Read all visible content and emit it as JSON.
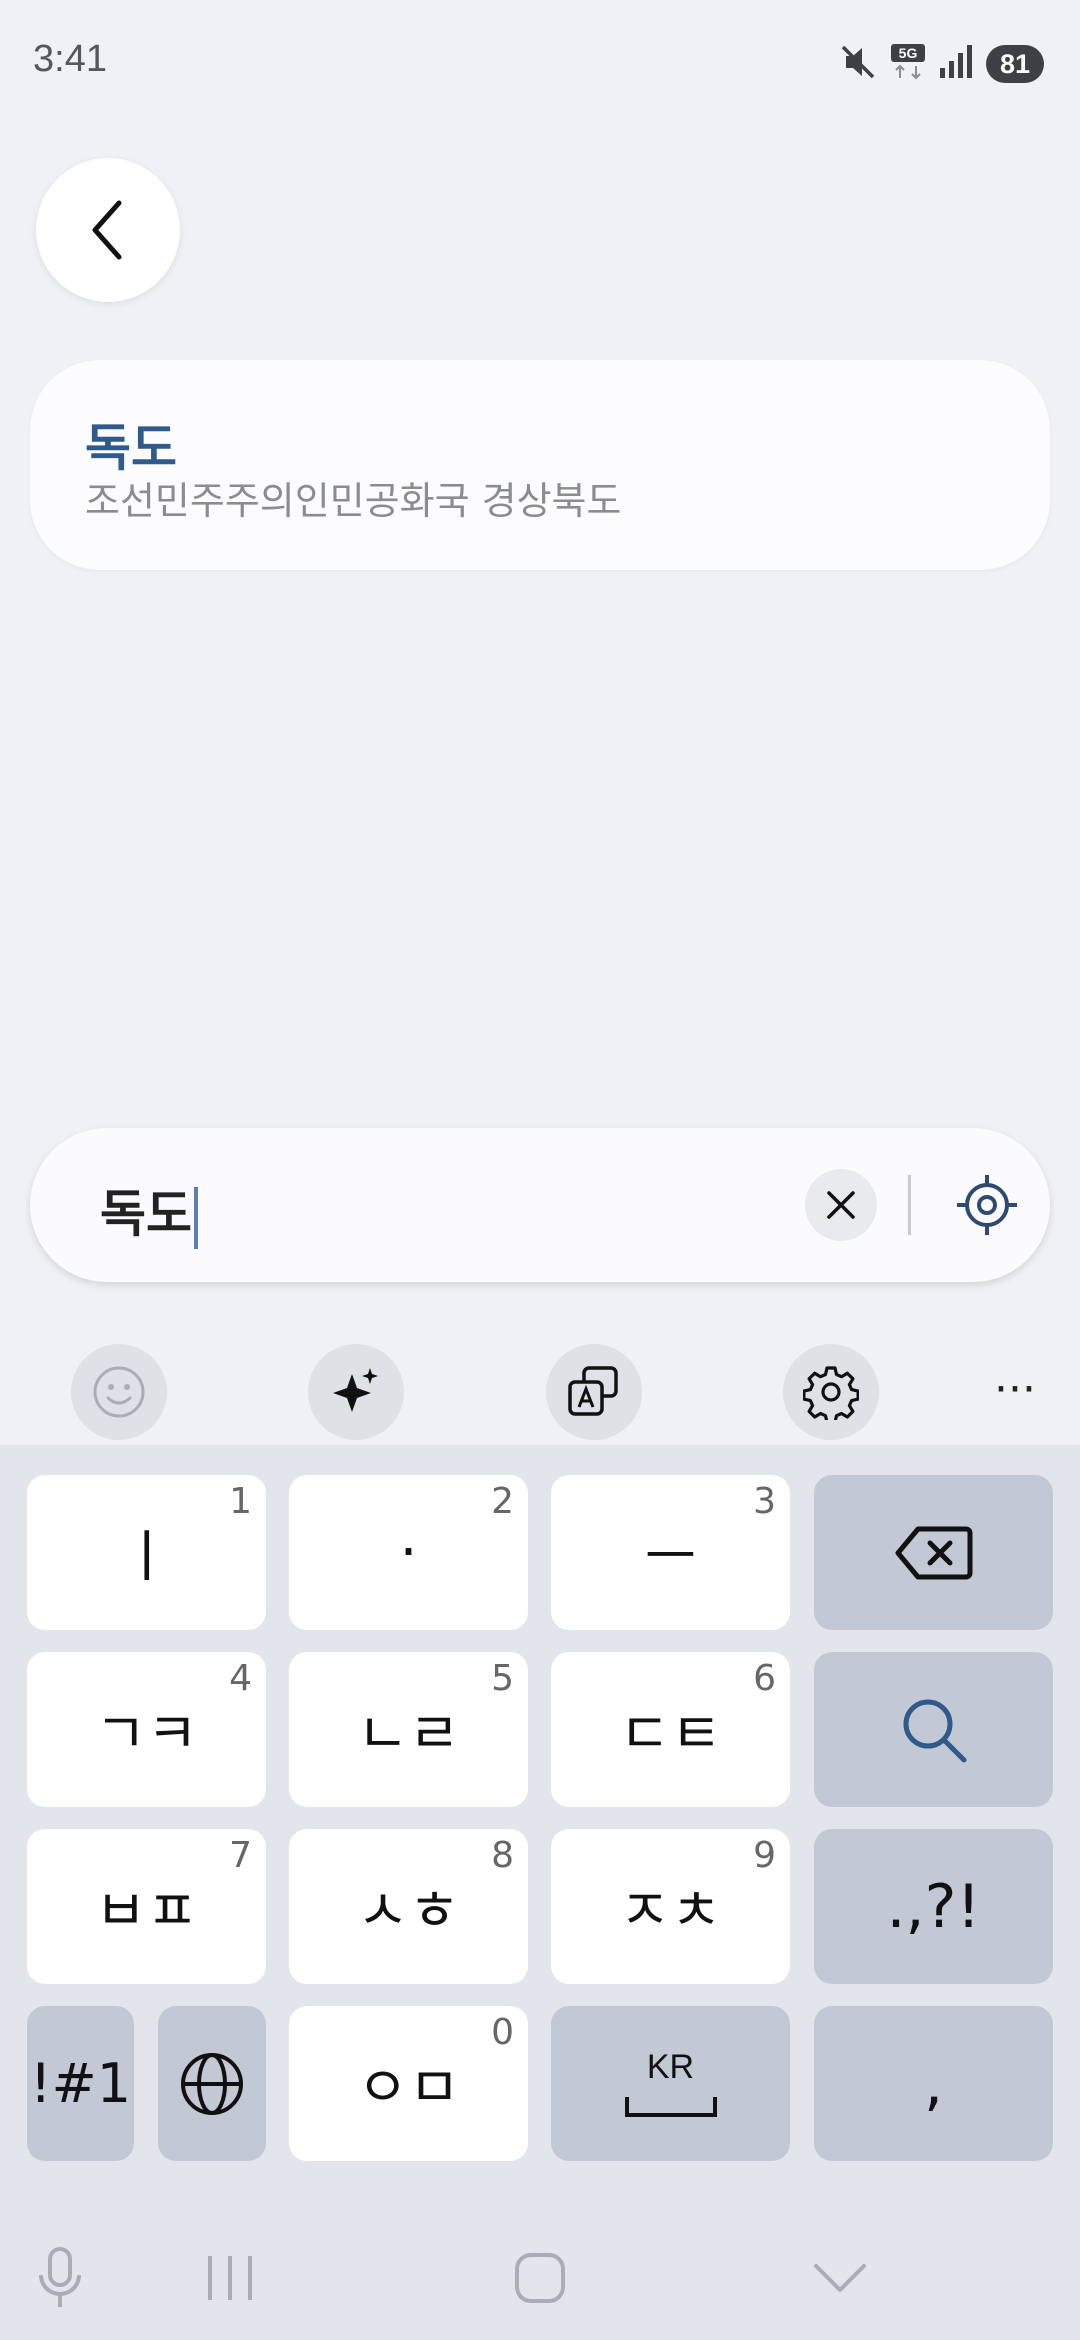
{
  "status_bar": {
    "time": "3:41",
    "network": "5G",
    "battery": "81",
    "icons": [
      "mute-icon",
      "5g-icon",
      "signal-icon",
      "battery-icon"
    ]
  },
  "result": {
    "title": "독도",
    "subtitle": "조선민주주의인민공화국 경상북도"
  },
  "search": {
    "value": "독도"
  },
  "toolbar": {
    "icons": [
      "emoji-icon",
      "sparkle-icon",
      "translate-icon",
      "settings-icon",
      "more-icon"
    ],
    "more_label": "···"
  },
  "keyboard": {
    "rows": [
      [
        {
          "label": "ㅣ",
          "num": "1"
        },
        {
          "label": "·",
          "num": "2"
        },
        {
          "label": "ㅡ",
          "num": "3"
        },
        {
          "label": "backspace"
        }
      ],
      [
        {
          "label": "ㄱㅋ",
          "num": "4"
        },
        {
          "label": "ㄴㄹ",
          "num": "5"
        },
        {
          "label": "ㄷㅌ",
          "num": "6"
        },
        {
          "label": "search"
        }
      ],
      [
        {
          "label": "ㅂㅍ",
          "num": "7"
        },
        {
          "label": "ㅅㅎ",
          "num": "8"
        },
        {
          "label": "ㅈㅊ",
          "num": "9"
        },
        {
          "label": ".,?!"
        }
      ],
      [
        {
          "label": "!#1"
        },
        {
          "label": "globe"
        },
        {
          "label": "ㅇㅁ",
          "num": "0"
        },
        {
          "label": "KR"
        },
        {
          "label": ","
        }
      ]
    ],
    "key_1": "ㅣ",
    "key_1_num": "1",
    "key_2": "·",
    "key_2_num": "2",
    "key_3": "ㅡ",
    "key_3_num": "3",
    "key_4": "ㄱㅋ",
    "key_4_num": "4",
    "key_5": "ㄴㄹ",
    "key_5_num": "5",
    "key_6": "ㄷㅌ",
    "key_6_num": "6",
    "key_7": "ㅂㅍ",
    "key_7_num": "7",
    "key_8": "ㅅㅎ",
    "key_8_num": "8",
    "key_9": "ㅈㅊ",
    "key_9_num": "9",
    "key_0": "ㅇㅁ",
    "key_0_num": "0",
    "punct": ".,?!",
    "symbols": "!#1",
    "space_label": "KR",
    "comma": ","
  },
  "colors": {
    "background": "#eff1f5",
    "accent": "#2f5a8a",
    "function_key": "#c2c9d5",
    "keyboard_bg": "#e2e6ec"
  }
}
